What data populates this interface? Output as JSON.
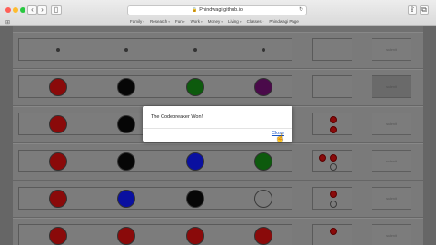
{
  "browser": {
    "address": "Phindwagi.github.io",
    "bookmarks": [
      {
        "label": "Family"
      },
      {
        "label": "Research"
      },
      {
        "label": "Fun"
      },
      {
        "label": "Work"
      },
      {
        "label": "Money"
      },
      {
        "label": "Living"
      },
      {
        "label": "Classes"
      },
      {
        "label": "Phindwagi Page"
      }
    ]
  },
  "colors": {
    "red": "#8a0a0a",
    "black": "#060606",
    "green": "#0d5a0d",
    "purple": "#4a0a4a",
    "blue": "#0a10a0",
    "empty": "transparent"
  },
  "board": {
    "rows": [
      {
        "pegs": [
          "dot",
          "dot",
          "dot",
          "dot"
        ],
        "feedback": [],
        "submit_label": "submit",
        "submit_active": false
      },
      {
        "pegs": [
          "red",
          "black",
          "green",
          "purple"
        ],
        "feedback": [],
        "submit_label": "submit",
        "submit_active": true
      },
      {
        "pegs": [
          "red",
          "black",
          "empty-hidden",
          "empty-hidden"
        ],
        "feedback": [
          "red",
          "red"
        ],
        "submit_label": "submit",
        "submit_active": false
      },
      {
        "pegs": [
          "red",
          "black",
          "blue",
          "green"
        ],
        "feedback": [
          "red",
          "red",
          "white"
        ],
        "submit_label": "submit",
        "submit_active": false
      },
      {
        "pegs": [
          "red",
          "blue",
          "black",
          "empty"
        ],
        "feedback": [
          "red",
          "white"
        ],
        "submit_label": "submit",
        "submit_active": false
      },
      {
        "pegs": [
          "red",
          "red",
          "red",
          "red"
        ],
        "feedback": [
          "red"
        ],
        "submit_label": "submit",
        "submit_active": false
      }
    ]
  },
  "modal": {
    "message": "The Codebreaker Won!",
    "close_label": "Close"
  }
}
